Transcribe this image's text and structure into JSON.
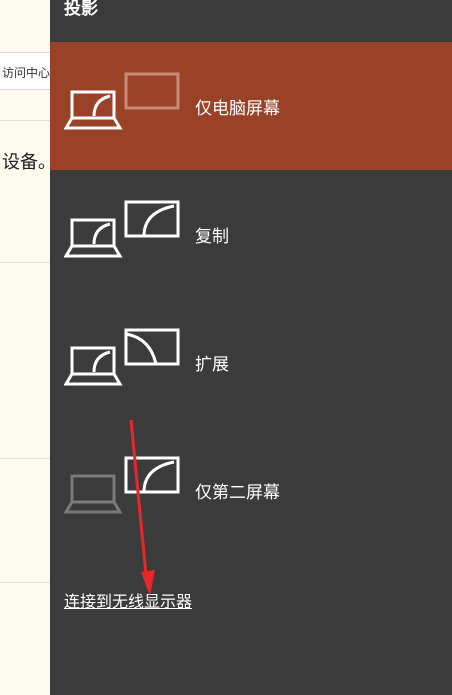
{
  "background_app": {
    "tab_text": "访问中心",
    "body_text": "设备。"
  },
  "panel": {
    "title": "投影",
    "options": [
      {
        "label": "仅电脑屏幕",
        "selected": true
      },
      {
        "label": "复制",
        "selected": false
      },
      {
        "label": "扩展",
        "selected": false
      },
      {
        "label": "仅第二屏幕",
        "selected": false
      }
    ],
    "connect_link": "连接到无线显示器"
  },
  "colors": {
    "panel_bg": "#3b3b3b",
    "selected_bg": "#9a4228",
    "annotation_arrow": "#e8262b"
  },
  "icons": [
    "laptop-icon",
    "monitor-icon"
  ]
}
